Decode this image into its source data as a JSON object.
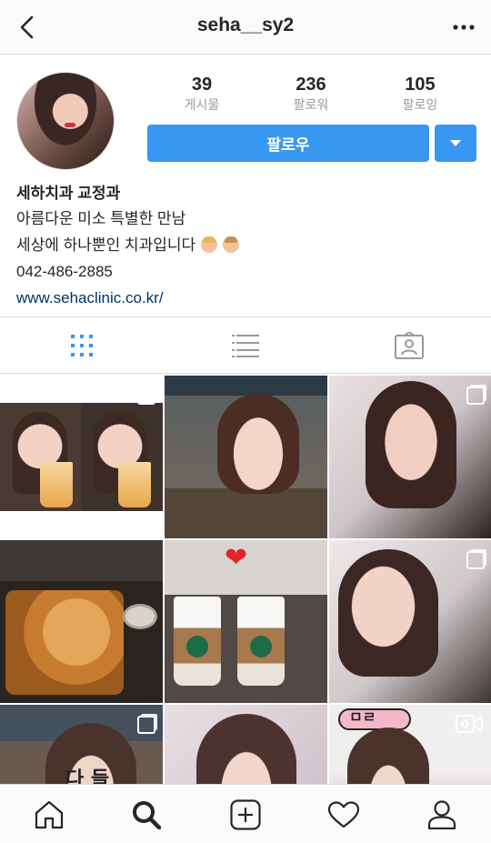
{
  "header": {
    "username": "seha__sy2",
    "back_icon": "chevron-left-icon",
    "more_icon": "more-horizontal-icon"
  },
  "profile": {
    "stats": [
      {
        "value": "39",
        "label": "게시물"
      },
      {
        "value": "236",
        "label": "팔로워"
      },
      {
        "value": "105",
        "label": "팔로잉"
      }
    ],
    "follow_label": "팔로우",
    "dropdown_icon": "caret-down-icon"
  },
  "bio": {
    "name": "세하치과 교정과",
    "line1": "아름다운 미소 특별한 만남",
    "line2": "세상에 하나뿐인 치과입니다",
    "phone": "042-486-2885",
    "website": "www.sehaclinic.co.kr/"
  },
  "tabs": [
    {
      "icon": "grid-icon",
      "active": true
    },
    {
      "icon": "list-icon",
      "active": false
    },
    {
      "icon": "tagged-icon",
      "active": false
    }
  ],
  "grid": {
    "stickers": {
      "p7": "다 들",
      "p9": "ㅁㄹ"
    }
  },
  "colors": {
    "accent": "#3897f0",
    "link": "#003569",
    "border": "#dbdbdb",
    "muted": "#999999"
  },
  "bottom_nav": [
    {
      "icon": "home-icon"
    },
    {
      "icon": "search-icon"
    },
    {
      "icon": "add-post-icon"
    },
    {
      "icon": "heart-icon"
    },
    {
      "icon": "profile-icon"
    }
  ]
}
